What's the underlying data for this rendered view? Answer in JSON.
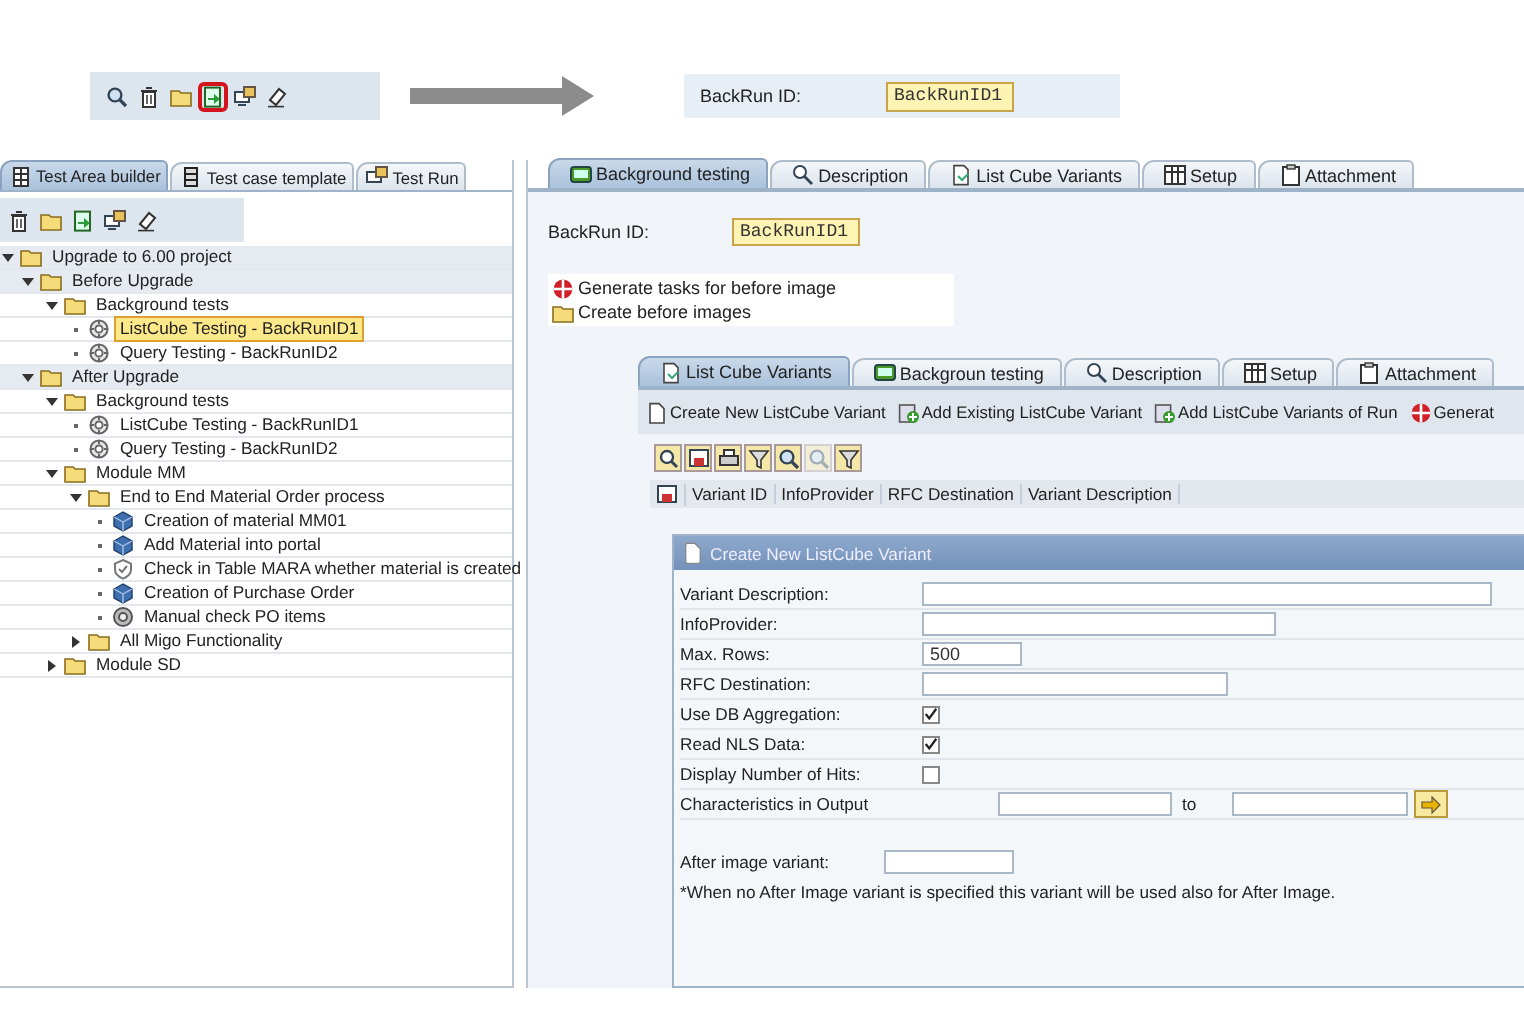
{
  "top_toolbar": {
    "buttons": [
      {
        "kind": "find",
        "highlighted": false
      },
      {
        "kind": "trash",
        "highlighted": false
      },
      {
        "kind": "folder",
        "highlighted": false
      },
      {
        "kind": "transfer",
        "highlighted": true
      },
      {
        "kind": "screen",
        "highlighted": false
      },
      {
        "kind": "eraser",
        "highlighted": false
      }
    ]
  },
  "top_field": {
    "label": "BackRun ID:",
    "value": "BackRunID1"
  },
  "left_tabs": [
    {
      "kind": "builder",
      "label": "Test Area builder",
      "selected": true
    },
    {
      "kind": "template",
      "label": "Test case template",
      "selected": false
    },
    {
      "kind": "run",
      "label": "Test Run",
      "selected": false
    }
  ],
  "tree_toolbar": {
    "buttons": [
      {
        "kind": "trash"
      },
      {
        "kind": "folder"
      },
      {
        "kind": "transfer"
      },
      {
        "kind": "screen"
      },
      {
        "kind": "eraser"
      }
    ]
  },
  "tree": [
    {
      "label": "Upgrade to 6.00 project",
      "kind": "folder",
      "expanded": true,
      "selected": false,
      "children": [
        {
          "label": "Before Upgrade",
          "kind": "folder",
          "expanded": true,
          "selected": false,
          "children": [
            {
              "label": "Background tests",
              "kind": "folder",
              "expanded": true,
              "selected": false,
              "children": [
                {
                  "label": "ListCube Testing - BackRunID1",
                  "kind": "test",
                  "selected": true
                },
                {
                  "label": "Query Testing - BackRunID2",
                  "kind": "test",
                  "selected": false
                }
              ]
            }
          ]
        },
        {
          "label": "After Upgrade",
          "kind": "folder",
          "expanded": true,
          "selected": false,
          "children": [
            {
              "label": "Background tests",
              "kind": "folder",
              "expanded": true,
              "selected": false,
              "children": [
                {
                  "label": "ListCube Testing - BackRunID1",
                  "kind": "test",
                  "selected": false
                },
                {
                  "label": "Query Testing - BackRunID2",
                  "kind": "test",
                  "selected": false
                }
              ]
            },
            {
              "label": "Module MM",
              "kind": "folder",
              "expanded": true,
              "selected": false,
              "children": [
                {
                  "label": "End to End Material Order process",
                  "kind": "folder",
                  "expanded": true,
                  "selected": false,
                  "children": [
                    {
                      "label": "Creation of material MM01",
                      "kind": "cube",
                      "selected": false
                    },
                    {
                      "label": "Add Material into portal",
                      "kind": "cube",
                      "selected": false
                    },
                    {
                      "label": "Check in Table MARA whether material is created",
                      "kind": "check",
                      "selected": false
                    },
                    {
                      "label": "Creation of Purchase Order",
                      "kind": "cube",
                      "selected": false
                    },
                    {
                      "label": "Manual check PO items",
                      "kind": "manual",
                      "selected": false
                    }
                  ]
                },
                {
                  "label": "All Migo Functionality",
                  "kind": "folder",
                  "expanded": false,
                  "selected": false
                }
              ]
            },
            {
              "label": "Module SD",
              "kind": "folder",
              "expanded": false,
              "selected": false
            }
          ]
        }
      ]
    }
  ],
  "right_tabs": [
    {
      "kind": "background",
      "label": "Background testing",
      "selected": true
    },
    {
      "kind": "description",
      "label": "Description",
      "selected": false
    },
    {
      "kind": "variants",
      "label": "List Cube Variants",
      "selected": false
    },
    {
      "kind": "setup",
      "label": "Setup",
      "selected": false
    },
    {
      "kind": "attachment",
      "label": "Attachment",
      "selected": false
    }
  ],
  "backrun": {
    "label": "BackRun ID:",
    "value": "BackRunID1"
  },
  "actions": [
    {
      "kind": "generate",
      "label": "Generate tasks for before image"
    },
    {
      "kind": "folder",
      "label": "Create before images"
    }
  ],
  "variant_tabs": [
    {
      "kind": "variants",
      "label": "List Cube Variants",
      "selected": true
    },
    {
      "kind": "background",
      "label": "Backgroun testing",
      "selected": false
    },
    {
      "kind": "description",
      "label": "Description",
      "selected": false
    },
    {
      "kind": "setup",
      "label": "Setup",
      "selected": false
    },
    {
      "kind": "attachment",
      "label": "Attachment",
      "selected": false
    }
  ],
  "variant_toolbar": [
    {
      "kind": "new",
      "label": "Create New ListCube Variant"
    },
    {
      "kind": "add",
      "label": "Add Existing ListCube Variant"
    },
    {
      "kind": "add",
      "label": "Add ListCube Variants of Run"
    },
    {
      "kind": "generate",
      "label": "Generat"
    }
  ],
  "grid_toolbar": [
    {
      "kind": "details",
      "enabled": true
    },
    {
      "kind": "export",
      "enabled": true
    },
    {
      "kind": "print",
      "enabled": true
    },
    {
      "kind": "filter",
      "enabled": true
    },
    {
      "kind": "find",
      "enabled": true
    },
    {
      "kind": "find",
      "enabled": false
    },
    {
      "kind": "filter",
      "enabled": true
    }
  ],
  "table": {
    "columns": [
      "Variant ID",
      "InfoProvider",
      "RFC Destination",
      "Variant Description"
    ]
  },
  "dialog": {
    "title": "Create New ListCube Variant",
    "fields": [
      {
        "kind": "text",
        "label": "Variant Description:"
      },
      {
        "kind": "text",
        "label": "InfoProvider:"
      },
      {
        "kind": "text",
        "label": "Max. Rows:",
        "value": "500"
      },
      {
        "kind": "text",
        "label": "RFC Destination:"
      },
      {
        "kind": "checkbox",
        "label": "Use DB Aggregation:",
        "checked": true
      },
      {
        "kind": "checkbox",
        "label": "Read NLS Data:",
        "checked": true
      },
      {
        "kind": "checkbox",
        "label": "Display Number of Hits:",
        "checked": false
      },
      {
        "kind": "range",
        "label": "Characteristics in Output",
        "separator": "to"
      }
    ],
    "after_image": {
      "label": "After image variant:"
    },
    "note": "*When no After Image variant is specified this variant will be used also for After Image."
  }
}
